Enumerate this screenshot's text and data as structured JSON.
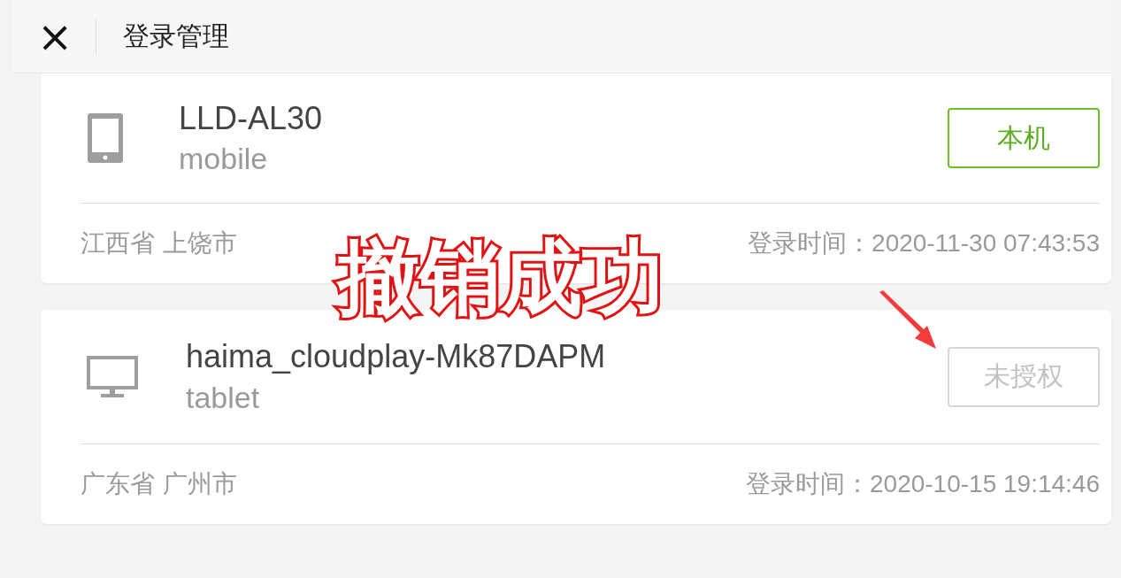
{
  "header": {
    "close_icon": "×",
    "title": "登录管理"
  },
  "devices": [
    {
      "name": "LLD-AL30",
      "type": "mobile",
      "kind": "phone",
      "button": {
        "label": "本机",
        "kind": "current"
      },
      "region": "江西省 上饶市",
      "login_time": "登录时间：2020-11-30 07:43:53"
    },
    {
      "name": "haima_cloudplay-Mk87DAPM",
      "type": "tablet",
      "kind": "monitor",
      "button": {
        "label": "未授权",
        "kind": "revoked"
      },
      "region": "广东省 广州市",
      "login_time": "登录时间：2020-10-15 19:14:46"
    }
  ],
  "annotation": {
    "text": "撤销成功"
  }
}
